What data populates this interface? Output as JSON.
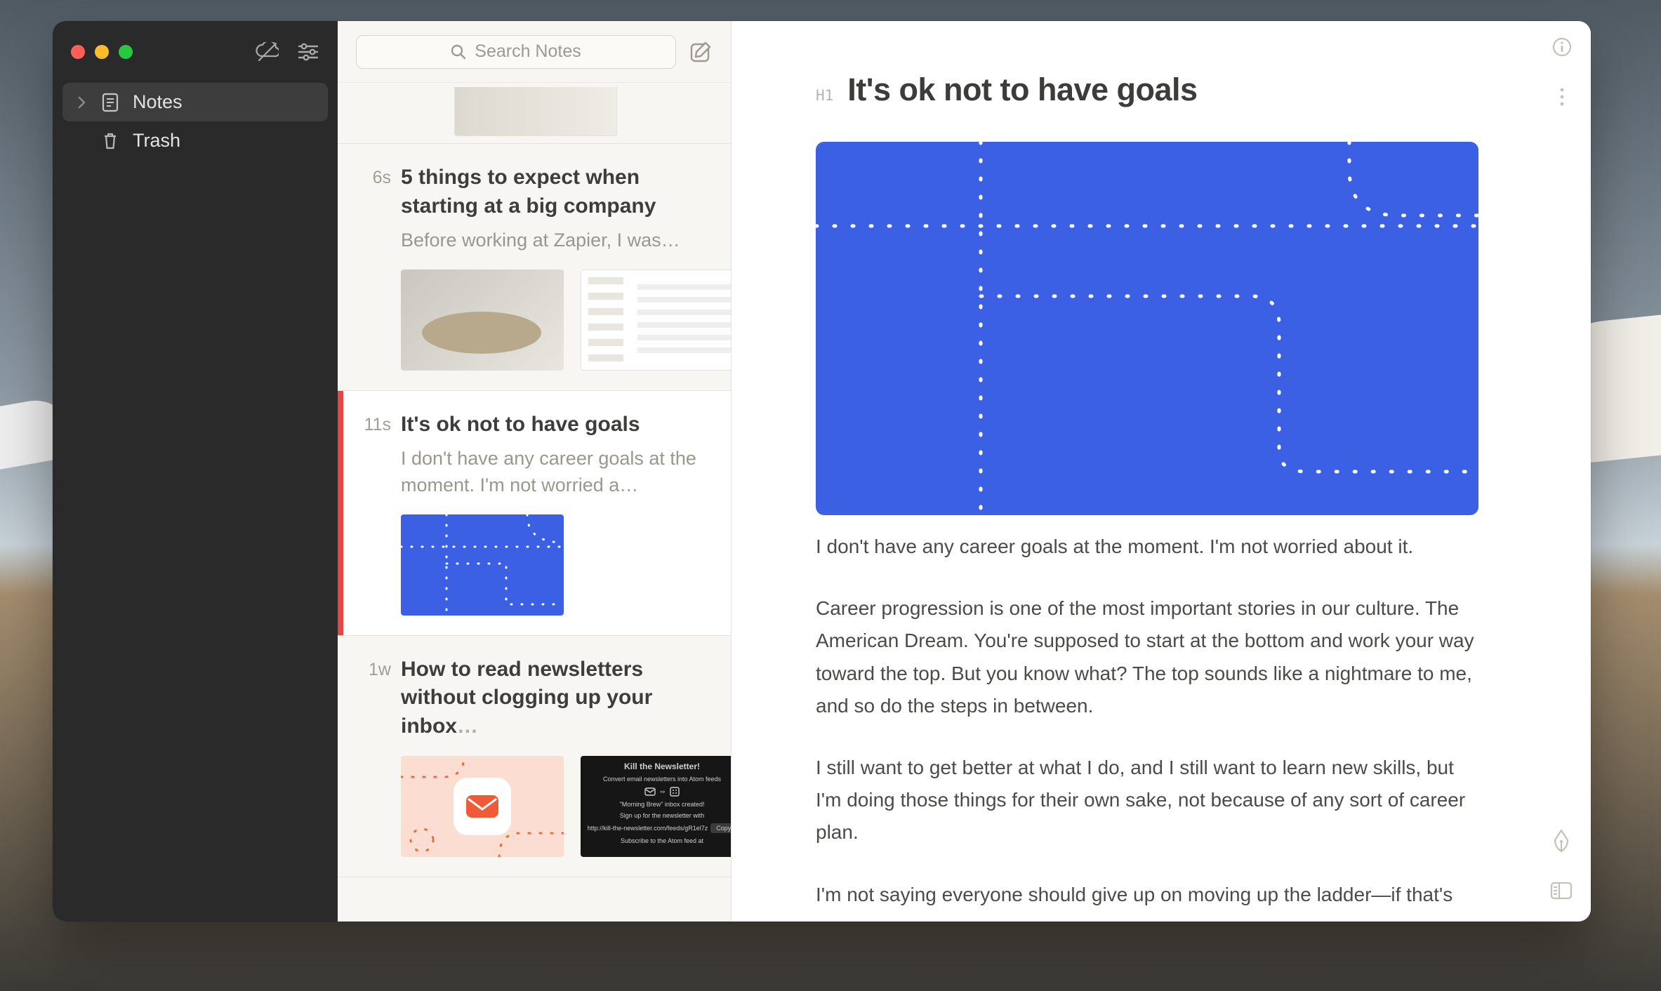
{
  "h1_tag": "H1",
  "sidebar": {
    "items": [
      {
        "label": "Notes"
      },
      {
        "label": "Trash"
      }
    ]
  },
  "search": {
    "placeholder": "Search Notes"
  },
  "notes": [
    {
      "time": "6s",
      "title": "5 things to expect when starting at a big company",
      "excerpt": "Before working at Zapier, I was…"
    },
    {
      "time": "11s",
      "title": "It's ok not to have goals",
      "excerpt": "I don't have any career goals at the moment. I'm not worried a…",
      "selected": true
    },
    {
      "time": "1w",
      "title": "How to read newsletters without clogging up your inbox",
      "title_has_ellipsis": true,
      "excerpt": ""
    }
  ],
  "doc": {
    "title": "It's ok not to have goals",
    "paragraphs": [
      "I don't have any career goals at the moment. I'm not worried about it.",
      "Career progression is one of the most important stories in our culture. The American Dream. You're supposed to start at the bottom and work your way toward the top. But you know what? The top sounds like a nightmare to me, and so do the steps in between.",
      "I still want to get better at what I do, and I still want to learn new skills, but I'm doing those things for their own sake, not because of any sort of career plan.",
      "I'm not saying everyone should give up on moving up the ladder—if that's"
    ]
  },
  "kill_thumb": {
    "title": "Kill the Newsletter!",
    "line1": "Convert email newsletters into Atom feeds",
    "line2": "\"Morning Brew\" inbox created!",
    "line3": "Sign up for the newsletter with",
    "line4": "http://kill-the-newsletter.com/feeds/gR1el7z",
    "button": "Copy",
    "line5": "Subscribe to the Atom feed at"
  }
}
